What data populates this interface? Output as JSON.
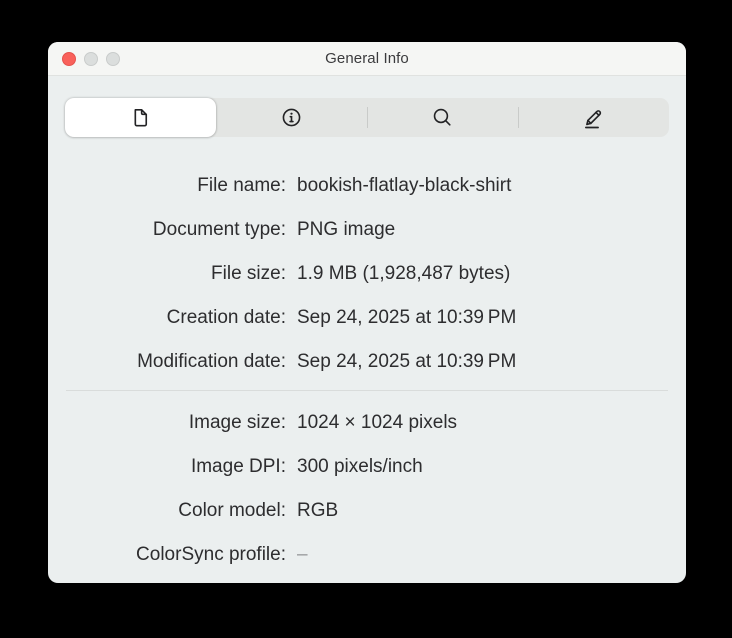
{
  "window": {
    "title": "General Info"
  },
  "traffic_lights": {
    "close_color": "#f9615b",
    "disabled_color": "#dbdedd"
  },
  "tabbar": {
    "selected_index": 0,
    "tabs": [
      {
        "name": "general-info",
        "icon": "document-icon",
        "selected": true
      },
      {
        "name": "more-info",
        "icon": "info-circle-icon",
        "selected": false
      },
      {
        "name": "keywords",
        "icon": "search-icon",
        "selected": false
      },
      {
        "name": "annotations",
        "icon": "markup-pencil-icon",
        "selected": false
      }
    ]
  },
  "panel": {
    "rows_top": [
      {
        "label": "File name:",
        "value": "bookish-flatlay-black-shirt"
      },
      {
        "label": "Document type:",
        "value": "PNG image"
      },
      {
        "label": "File size:",
        "value": "1.9 MB (1,928,487 bytes)"
      },
      {
        "label": "Creation date:",
        "value": "Sep 24, 2025 at 10:39 PM"
      },
      {
        "label": "Modification date:",
        "value": "Sep 24, 2025 at 10:39 PM"
      }
    ],
    "rows_bottom": [
      {
        "label": "Image size:",
        "value": "1024 × 1024 pixels"
      },
      {
        "label": "Image DPI:",
        "value": "300 pixels/inch"
      },
      {
        "label": "Color model:",
        "value": "RGB"
      },
      {
        "label": "ColorSync profile:",
        "value": "–"
      }
    ]
  },
  "colors": {
    "window_background": "#ebefef",
    "titlebar_background": "#f5f6f4",
    "segment_track": "#e3e5e3",
    "selected_segment": "#ffffff",
    "text": "#2d2d2f",
    "muted_text": "#97999b"
  }
}
